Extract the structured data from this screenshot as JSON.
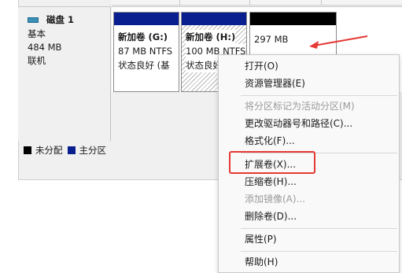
{
  "disk": {
    "name": "磁盘 1",
    "type": "基本",
    "size": "484 MB",
    "status": "联机"
  },
  "partitions": [
    {
      "title": "新加卷  (G:)",
      "size": "87 MB NTFS",
      "status": "状态良好 (基",
      "bar_color": "#0a1f8f"
    },
    {
      "title": "新加卷  (H:)",
      "size": "100 MB NTFS",
      "status": "状态良好 (基",
      "bar_color": "#0a1f8f"
    },
    {
      "title": "",
      "size": "297 MB",
      "status": "",
      "bar_color": "#000000"
    }
  ],
  "legend": {
    "unallocated": {
      "label": "未分配",
      "color": "#000000"
    },
    "primary": {
      "label": "主分区",
      "color": "#0a1f8f"
    }
  },
  "context_menu": {
    "open": "打开(O)",
    "explorer": "资源管理器(E)",
    "mark_active": "将分区标记为活动分区(M)",
    "change_letter": "更改驱动器号和路径(C)...",
    "format": "格式化(F)...",
    "extend": "扩展卷(X)...",
    "shrink": "压缩卷(H)...",
    "add_mirror": "添加镜像(A)...",
    "delete": "删除卷(D)...",
    "properties": "属性(P)",
    "help": "帮助(H)"
  },
  "colors": {
    "annotation_red": "#e53935",
    "primary_partition": "#0a1f8f",
    "unallocated": "#000000"
  }
}
